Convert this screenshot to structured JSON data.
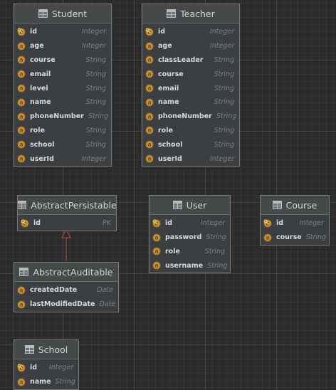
{
  "entities": [
    {
      "name": "Student",
      "fields": [
        {
          "name": "id",
          "type": "Integer",
          "key": true
        },
        {
          "name": "age",
          "type": "Integer"
        },
        {
          "name": "course",
          "type": "String"
        },
        {
          "name": "email",
          "type": "String"
        },
        {
          "name": "level",
          "type": "String"
        },
        {
          "name": "name",
          "type": "String"
        },
        {
          "name": "phoneNumber",
          "type": "String"
        },
        {
          "name": "role",
          "type": "String"
        },
        {
          "name": "school",
          "type": "String"
        },
        {
          "name": "userId",
          "type": "Integer"
        }
      ]
    },
    {
      "name": "Teacher",
      "fields": [
        {
          "name": "id",
          "type": "Integer",
          "key": true
        },
        {
          "name": "age",
          "type": "Integer"
        },
        {
          "name": "classLeader",
          "type": "String"
        },
        {
          "name": "course",
          "type": "String"
        },
        {
          "name": "email",
          "type": "String"
        },
        {
          "name": "name",
          "type": "String"
        },
        {
          "name": "phoneNumber",
          "type": "String"
        },
        {
          "name": "role",
          "type": "String"
        },
        {
          "name": "school",
          "type": "String"
        },
        {
          "name": "userId",
          "type": "Integer"
        }
      ]
    },
    {
      "name": "AbstractPersistable",
      "fields": [
        {
          "name": "id",
          "type": "PK",
          "key": true
        }
      ]
    },
    {
      "name": "User",
      "fields": [
        {
          "name": "id",
          "type": "Integer",
          "key": true
        },
        {
          "name": "password",
          "type": "String"
        },
        {
          "name": "role",
          "type": "String"
        },
        {
          "name": "username",
          "type": "String"
        }
      ]
    },
    {
      "name": "Course",
      "fields": [
        {
          "name": "id",
          "type": "Integer",
          "key": true
        },
        {
          "name": "course",
          "type": "String"
        }
      ]
    },
    {
      "name": "AbstractAuditable",
      "fields": [
        {
          "name": "createdDate",
          "type": "Date"
        },
        {
          "name": "lastModifiedDate",
          "type": "Date"
        }
      ]
    },
    {
      "name": "School",
      "fields": [
        {
          "name": "id",
          "type": "Integer",
          "key": true
        },
        {
          "name": "name",
          "type": "String"
        }
      ]
    }
  ],
  "relations": [
    {
      "type": "inheritance",
      "from": "AbstractAuditable",
      "to": "AbstractPersistable"
    }
  ],
  "colors": {
    "background": "#2b2b2b",
    "box": "#3c3f41",
    "field_icon": "#c8923a",
    "key_icon": "#e6c35c",
    "inherit_arrow": "#b0504a"
  },
  "icons": {
    "entity": "table-icon",
    "field": "field-icon",
    "key": "primary-key-icon"
  }
}
